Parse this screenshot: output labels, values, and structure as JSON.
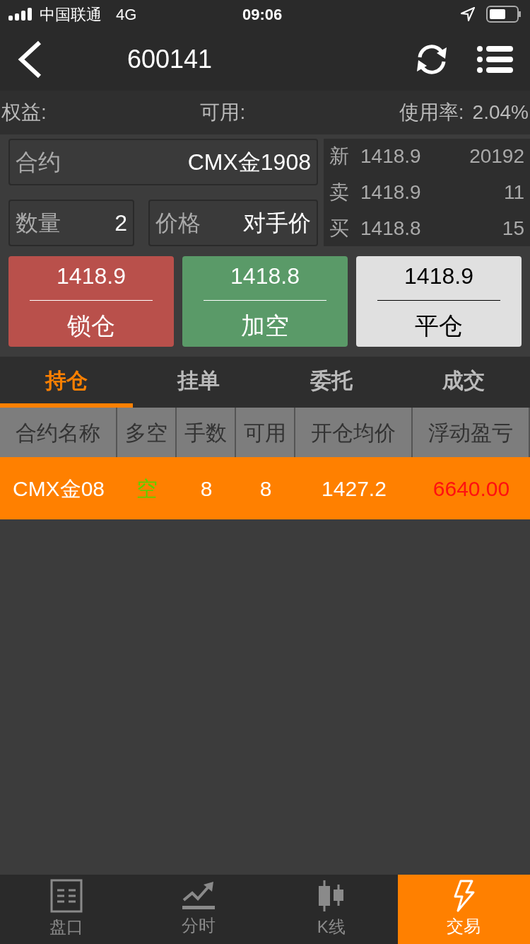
{
  "status_bar": {
    "carrier": "中国联通",
    "network": "4G",
    "time": "09:06"
  },
  "header": {
    "title": "600141"
  },
  "account": [
    {
      "label": "权益:"
    },
    {
      "label": "可用:"
    },
    {
      "label": "使用率:",
      "value": "2.04%"
    }
  ],
  "order_form": {
    "contract": {
      "label": "合约",
      "value": "CMX金1908"
    },
    "quantity": {
      "label": "数量",
      "value": "2"
    },
    "price": {
      "label": "价格",
      "value": "对手价"
    }
  },
  "quotes": [
    {
      "label": "新",
      "price": "1418.9",
      "volume": "20192"
    },
    {
      "label": "卖",
      "price": "1418.9",
      "volume": "11"
    },
    {
      "label": "买",
      "price": "1418.8",
      "volume": "15"
    }
  ],
  "actions": [
    {
      "kind": "red",
      "price": "1418.9",
      "label": "锁仓"
    },
    {
      "kind": "green",
      "price": "1418.8",
      "label": "加空"
    },
    {
      "kind": "light",
      "price": "1418.9",
      "label": "平仓"
    }
  ],
  "tabs": [
    {
      "label": "持仓",
      "selected": true
    },
    {
      "label": "挂单",
      "selected": false
    },
    {
      "label": "委托",
      "selected": false
    },
    {
      "label": "成交",
      "selected": false
    }
  ],
  "table": {
    "columns": [
      "合约名称",
      "多空",
      "手数",
      "可用",
      "开仓均价",
      "浮动盈亏"
    ],
    "rows": [
      {
        "selected": true,
        "cells": [
          "CMX金08",
          "空",
          "8",
          "8",
          "1427.2",
          "6640.00"
        ]
      }
    ]
  },
  "bottom_nav": [
    {
      "label": "盘口",
      "kind": "book",
      "selected": false
    },
    {
      "label": "分时",
      "kind": "timeshare",
      "selected": false
    },
    {
      "label": "K线",
      "kind": "kline",
      "selected": false
    },
    {
      "label": "交易",
      "kind": "trade",
      "selected": true
    }
  ]
}
